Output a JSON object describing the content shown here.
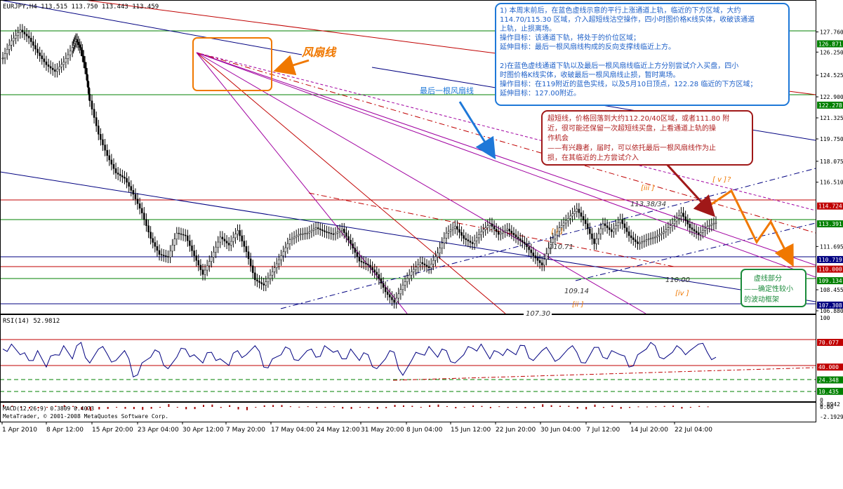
{
  "header": {
    "symbol_line": "EURJPY,H4  113.515 113.750 113.443 113.459"
  },
  "copyright": "MetaTrader, © 2001-2008 MetaQuotes Software Corp.",
  "colors": {
    "border": "#000000",
    "candle": "#000000",
    "green_line": "#008000",
    "red_line": "#c00000",
    "navy_line": "#000080",
    "magenta_line": "#a000a0",
    "orange": "#f07800",
    "blue_note": "#1e78d8",
    "red_note": "#b02020",
    "green_note": "#1a8a3a"
  },
  "chart_data": [
    {
      "type": "line",
      "title": "EURJPY,H4  113.515 113.750 113.443 113.459",
      "ylim": [
        106.88,
        129.1
      ],
      "x_tick_labels": [
        "1 Apr 2010",
        "8 Apr 12:00",
        "15 Apr 20:00",
        "23 Apr 04:00",
        "30 Apr 12:00",
        "7 May 20:00",
        "17 May 04:00",
        "24 May 12:00",
        "31 May 20:00",
        "8 Jun 04:00",
        "15 Jun 12:00",
        "22 Jun 20:00",
        "30 Jun 04:00",
        "7 Jul 12:00",
        "14 Jul 20:00",
        "22 Jul 04:00"
      ],
      "y_tick_labels": [
        {
          "label": "127.760",
          "value": 127.76
        },
        {
          "label": "126.250",
          "value": 126.25
        },
        {
          "label": "124.525",
          "value": 124.525
        },
        {
          "label": "122.900",
          "value": 122.9
        },
        {
          "label": "121.325",
          "value": 121.325
        },
        {
          "label": "119.750",
          "value": 119.75
        },
        {
          "label": "118.075",
          "value": 118.075
        },
        {
          "label": "116.510",
          "value": 116.51
        },
        {
          "label": "111.695",
          "value": 111.695
        },
        {
          "label": "108.455",
          "value": 108.455
        },
        {
          "label": "106.880",
          "value": 106.88
        }
      ],
      "price_tags": [
        {
          "label": "126.871",
          "value": 126.871,
          "color": "#008000"
        },
        {
          "label": "122.278",
          "value": 122.278,
          "color": "#008000"
        },
        {
          "label": "114.724",
          "value": 114.724,
          "color": "#c00000"
        },
        {
          "label": "113.391",
          "value": 113.391,
          "color": "#008000"
        },
        {
          "label": "110.719",
          "value": 110.719,
          "color": "#000080"
        },
        {
          "label": "110.000",
          "value": 110.0,
          "color": "#c00000"
        },
        {
          "label": "109.134",
          "value": 109.134,
          "color": "#008000"
        },
        {
          "label": "107.308",
          "value": 107.308,
          "color": "#000080"
        }
      ],
      "series": [
        {
          "x": [
            0,
            5,
            10,
            15,
            20,
            25,
            30,
            35,
            40,
            42,
            45,
            48,
            50,
            55,
            60,
            65,
            70,
            75,
            80,
            85,
            90,
            95,
            100,
            105,
            110,
            115,
            120,
            125,
            130,
            135,
            140,
            145,
            150,
            155,
            160,
            165,
            170,
            175,
            180,
            185,
            190,
            195,
            200,
            205,
            210,
            215,
            220,
            225,
            230,
            235,
            240,
            245,
            250,
            255,
            260,
            265,
            270,
            275,
            280,
            285,
            290,
            295,
            300,
            305,
            310,
            315,
            320,
            325,
            330,
            335,
            340,
            345,
            350,
            355,
            360,
            365,
            370,
            375,
            380,
            385,
            390,
            395,
            400,
            405,
            410
          ],
          "values": [
            125.8,
            127.1,
            127.9,
            127.3,
            126.2,
            125.3,
            124.8,
            125.5,
            126.6,
            127.2,
            126.4,
            124.6,
            122.6,
            120.1,
            118.5,
            117.2,
            116.8,
            115.6,
            114.2,
            112.3,
            111.1,
            110.9,
            112.7,
            112.5,
            111.0,
            109.6,
            110.9,
            112.4,
            111.8,
            112.9,
            111.3,
            109.2,
            108.8,
            109.8,
            111.0,
            112.2,
            112.6,
            112.7,
            113.1,
            112.8,
            112.6,
            113.0,
            111.9,
            110.6,
            110.3,
            109.6,
            108.3,
            107.5,
            108.8,
            109.8,
            110.5,
            110.1,
            111.2,
            112.7,
            113.2,
            112.3,
            111.9,
            112.8,
            113.4,
            112.6,
            113.0,
            112.4,
            111.9,
            111.0,
            110.3,
            112.0,
            113.1,
            113.8,
            114.5,
            113.4,
            111.9,
            113.4,
            112.8,
            113.7,
            112.5,
            111.9,
            112.2,
            112.4,
            112.8,
            113.4,
            114.2,
            113.1,
            112.6,
            113.2,
            113.5
          ]
        }
      ],
      "annotations": [
        {
          "text": "风扇线"
        },
        {
          "text": "最后一根风扇线"
        },
        {
          "text": "113.38/34"
        },
        {
          "text": "110.71"
        },
        {
          "text": "109.14"
        },
        {
          "text": "110.00"
        },
        {
          "text": "107.30"
        },
        {
          "text": "[ i ]"
        },
        {
          "text": "[ii ]"
        },
        {
          "text": "[iii ]"
        },
        {
          "text": "[iv ]"
        },
        {
          "text": "[ v ]"
        },
        {
          "text": "?"
        }
      ],
      "notes": {
        "blue": [
          "1) 本周末前后，在蓝色虚线示意的平行上涨通道上轨，临近的下方区域，大约",
          "114.70/115.30 区域，介入超短线沽空操作，四小时图价格K线实体，收破该通道",
          "上轨，止损离场。",
          "操作目标：该通道下轨，将处于的价位区域；",
          "延伸目标：最后一根风扇线构成的反向支撑线临近上方。",
          "",
          "2)在蓝色虚线通道下轨以及最后一根风扇线临近上方分别尝试介入买盘，四小",
          "时图价格K线实体，收破最后一根风扇线止损，暂时离场。",
          "操作目标：在119附近的蓝色实线，以及5月10日顶点，122.28 临近的下方区域；",
          "延伸目标：127.00附近。"
        ],
        "red": [
          "超短线，价格回落到大约112.20/40区域，或者111.80 附",
          "近，很可能还保留一次超短线买盘，上看通道上轨的操",
          "作机会",
          "——有兴趣者，届时，可以依托最后一根风扇线作为止",
          "损，在其临近的上方尝试介入"
        ],
        "green": [
          "虚线部分",
          "——确定性较小",
          "的波动框架"
        ]
      }
    },
    {
      "type": "line",
      "title": "RSI(14) 52.9812",
      "ylim": [
        0,
        100
      ],
      "y_tick_labels": [
        {
          "label": "100",
          "value": 100
        },
        {
          "label": "0",
          "value": 0
        }
      ],
      "price_tags": [
        {
          "label": "70.077",
          "value": 70.077,
          "color": "#c00000"
        },
        {
          "label": "40.000",
          "value": 40.0,
          "color": "#c00000"
        },
        {
          "label": "24.348",
          "value": 24.348,
          "color": "#008000"
        },
        {
          "label": "10.435",
          "value": 10.435,
          "color": "#008000"
        }
      ],
      "series": [
        {
          "x": [
            0,
            5,
            10,
            15,
            20,
            25,
            30,
            35,
            40,
            45,
            50,
            55,
            60,
            65,
            70,
            75,
            80,
            85,
            90,
            95,
            100,
            105,
            110,
            115,
            120,
            125,
            130,
            135,
            140,
            145,
            150,
            155,
            160,
            165,
            170,
            175,
            180,
            185,
            190,
            195,
            200,
            205,
            210,
            215,
            220,
            225,
            230,
            235,
            240,
            245,
            250,
            255,
            260,
            265,
            270,
            275,
            280,
            285,
            290,
            295,
            300,
            305,
            310,
            315,
            320,
            325,
            330,
            335,
            340,
            345,
            350,
            355,
            360,
            365,
            370,
            375,
            380,
            385,
            390,
            395,
            400,
            405,
            410
          ],
          "values": [
            62,
            68,
            55,
            48,
            60,
            40,
            55,
            66,
            50,
            70,
            45,
            62,
            56,
            48,
            60,
            28,
            45,
            52,
            58,
            38,
            52,
            62,
            55,
            45,
            58,
            50,
            42,
            60,
            55,
            66,
            40,
            50,
            55,
            62,
            48,
            60,
            52,
            66,
            58,
            50,
            62,
            48,
            55,
            38,
            50,
            58,
            30,
            48,
            56,
            65,
            52,
            60,
            45,
            55,
            63,
            68,
            50,
            58,
            62,
            55,
            66,
            48,
            60,
            56,
            50,
            62,
            58,
            45,
            64,
            52,
            60,
            55,
            40,
            55,
            62,
            66,
            50,
            58,
            62,
            60,
            68,
            58,
            52
          ]
        }
      ]
    },
    {
      "type": "bar",
      "title": "MACD(12,26,9) 0.3809 0.4073",
      "y_tick_labels": [
        {
          "label": "0.8942",
          "value": 0.8942
        },
        {
          "label": "0.00",
          "value": 0.0
        },
        {
          "label": "-2.1929",
          "value": -2.1929
        }
      ]
    }
  ]
}
